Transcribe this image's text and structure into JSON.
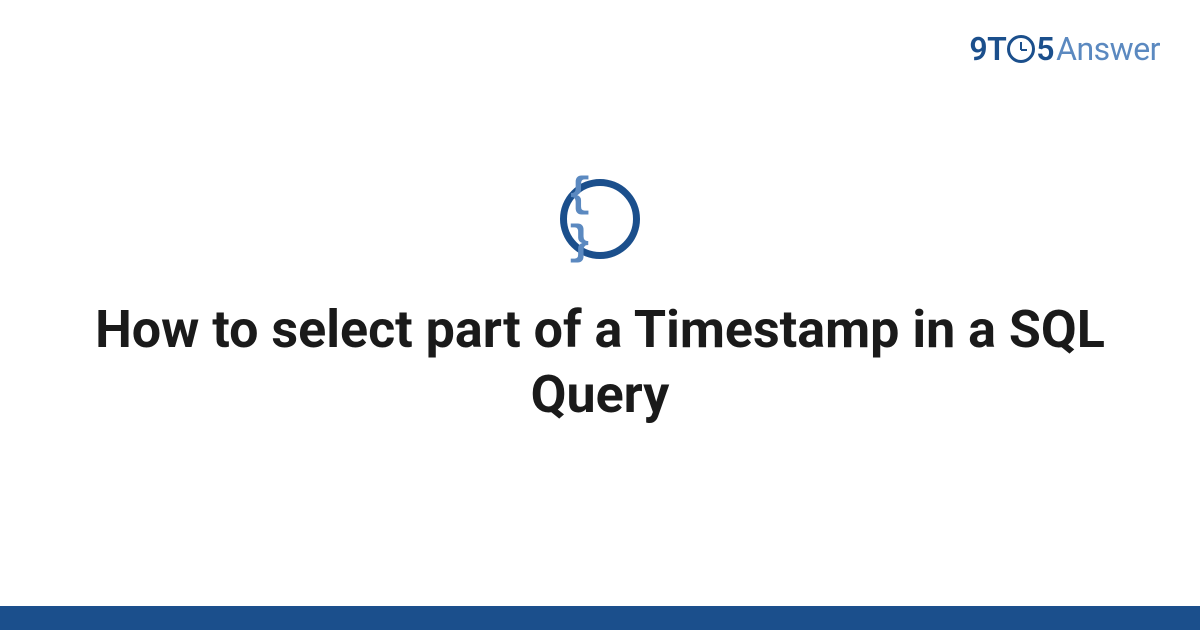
{
  "logo": {
    "part1": "9T",
    "part2": "5",
    "part3": "Answer"
  },
  "icon": {
    "name": "code-braces-icon",
    "glyph": "{ }"
  },
  "title": "How to select part of a Timestamp in a SQL Query",
  "colors": {
    "brand_primary": "#1b4f8c",
    "brand_secondary": "#5b89c0",
    "text": "#1a1a1a",
    "background": "#ffffff"
  }
}
